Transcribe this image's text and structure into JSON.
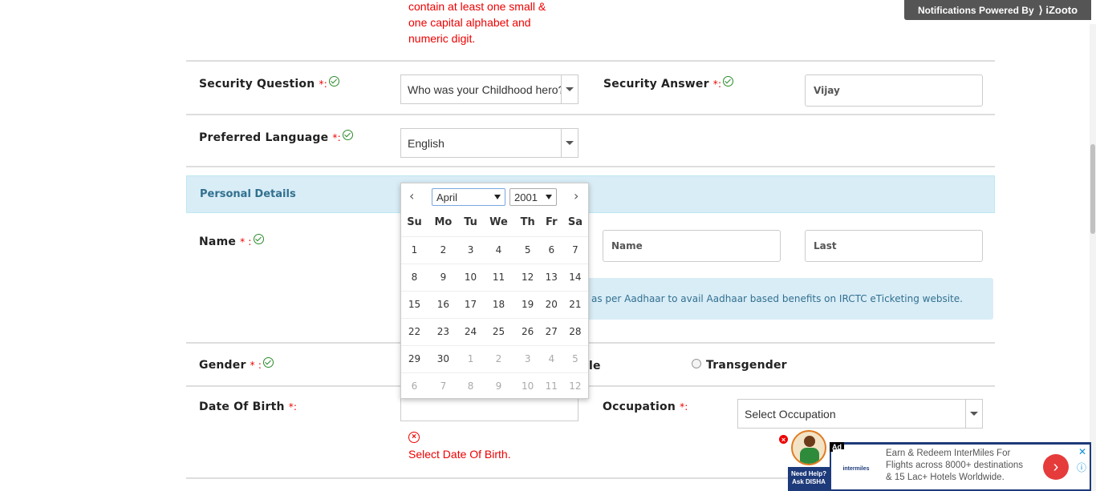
{
  "password_hint": [
    "contain at least one small &",
    "one capital alphabet and",
    "numeric digit."
  ],
  "notification_bar": {
    "text": "Notifications Powered By",
    "brand": "iZooto"
  },
  "security_question": {
    "label": "Security Question",
    "req": "*:",
    "value": "Who was your Childhood hero?"
  },
  "security_answer": {
    "label": "Security Answer",
    "req": "*:",
    "value": "Vijay"
  },
  "preferred_language": {
    "label": "Preferred Language",
    "req": "*:",
    "value": "English"
  },
  "personal_details": {
    "heading": "Personal Details"
  },
  "name": {
    "label": "Name",
    "req": "* :",
    "middle_placeholder": "Name",
    "last_placeholder": "Last",
    "note": "as per Aadhaar to avail Aadhaar based benefits on IRCTC eTicketing website."
  },
  "gender": {
    "label": "Gender",
    "req": "* :",
    "partial_option": "le",
    "transgender": "Transgender"
  },
  "dob": {
    "label": "Date Of Birth",
    "req": "*:",
    "error": "Select Date Of Birth."
  },
  "occupation": {
    "label": "Occupation",
    "req": "*:",
    "value": "Select Occupation"
  },
  "calendar": {
    "prev": "‹",
    "next": "›",
    "month": "April",
    "year": "2001",
    "weekdays": [
      "Su",
      "Mo",
      "Tu",
      "We",
      "Th",
      "Fr",
      "Sa"
    ],
    "weeks": [
      [
        "1",
        "2",
        "3",
        "4",
        "5",
        "6",
        "7"
      ],
      [
        "8",
        "9",
        "10",
        "11",
        "12",
        "13",
        "14"
      ],
      [
        "15",
        "16",
        "17",
        "18",
        "19",
        "20",
        "21"
      ],
      [
        "22",
        "23",
        "24",
        "25",
        "26",
        "27",
        "28"
      ],
      [
        "29",
        "30",
        "1",
        "2",
        "3",
        "4",
        "5"
      ],
      [
        "6",
        "7",
        "8",
        "9",
        "10",
        "11",
        "12"
      ]
    ]
  },
  "disha": {
    "line1": "Need Help?",
    "line2": "Ask DISHA"
  },
  "ad": {
    "badge": "Ad",
    "brand": "intermiles",
    "text": [
      "Earn & Redeem InterMiles For",
      "Flights across 8000+ destinations",
      "& 15 Lac+ Hotels Worldwide."
    ],
    "close": "✕",
    "info": "ⓘ"
  }
}
